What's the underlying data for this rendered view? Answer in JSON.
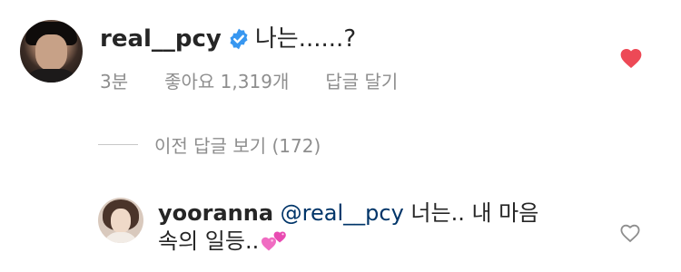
{
  "comment": {
    "username": "real__pcy",
    "text": "나는......?",
    "time": "3분",
    "likes": "좋아요 1,319개",
    "reply_label": "답글 달기"
  },
  "view_previous_replies": "이전 답글 보기 (172)",
  "reply": {
    "username": "yooranna",
    "mention": "@real__pcy",
    "text_line1": " 너는.. 내 마음",
    "text_line2": "속의 일등.."
  },
  "colors": {
    "primary_text": "#262626",
    "secondary_text": "#8e8e8e",
    "verified_blue": "#3897f0",
    "like_red": "#ed4956",
    "mention_blue": "#003569"
  },
  "icons": {
    "verified": "verified-badge-icon",
    "liked": "heart-filled-icon",
    "unliked": "heart-outline-icon",
    "emoji": "two-hearts-emoji"
  }
}
